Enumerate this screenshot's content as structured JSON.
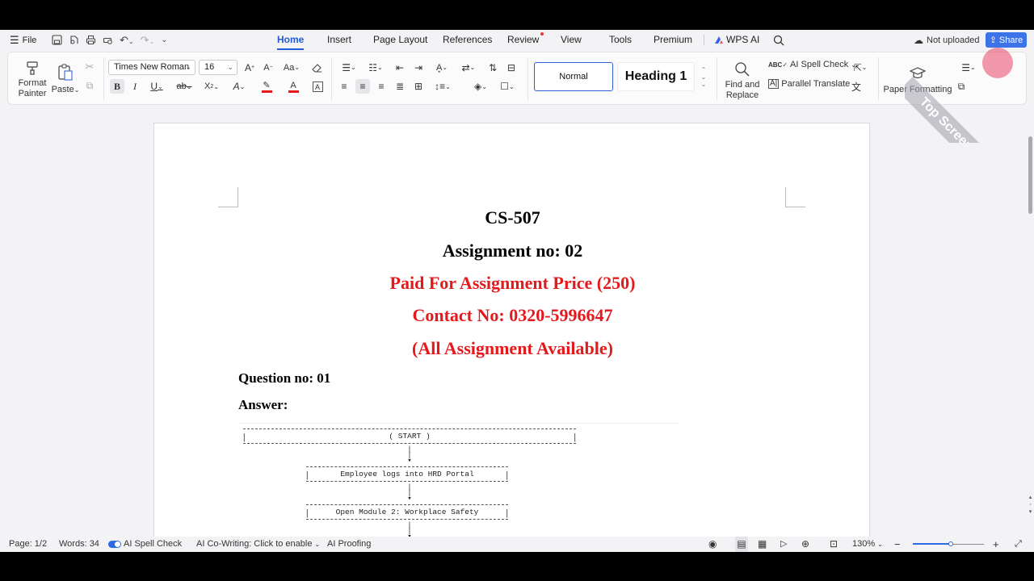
{
  "menubar": {
    "file_label": "File",
    "tabs": [
      "Home",
      "Insert",
      "Page Layout",
      "References",
      "Review",
      "View",
      "Tools",
      "Premium"
    ],
    "wps_ai": "WPS AI",
    "upload_status": "Not uploaded",
    "share_label": "Share"
  },
  "ribbon": {
    "format_painter": "Format Painter",
    "paste": "Paste",
    "font_name": "Times New Roman",
    "font_size": "16",
    "style_normal": "Normal",
    "style_heading1": "Heading 1",
    "find_replace": "Find and Replace",
    "ai_spell_check": "AI Spell Check",
    "parallel_translate": "Parallel Translate",
    "paper_formatting": "Paper Formatting"
  },
  "document": {
    "line1": "CS-507",
    "line2": "Assignment no: 02",
    "line3": "Paid For Assignment Price (250)",
    "line4": "Contact No: 0320-5996647",
    "line5": "(All Assignment Available)",
    "question": "Question no: 01",
    "answer": "Answer:",
    "flow": [
      "( START )",
      "Employee logs into HRD Portal",
      "Open Module 2: Workplace Safety"
    ]
  },
  "statusbar": {
    "page": "Page: 1/2",
    "words": "Words: 34",
    "ai_spell": "AI Spell Check",
    "ai_cowriting": "AI Co-Writing: Click to enable",
    "ai_proofing": "AI Proofing",
    "zoom": "130%"
  },
  "watermark": "Top Screen Recorder",
  "colors": {
    "accent": "#1f5bd8",
    "doc_red": "#e5191c",
    "share": "#3d73e8"
  }
}
